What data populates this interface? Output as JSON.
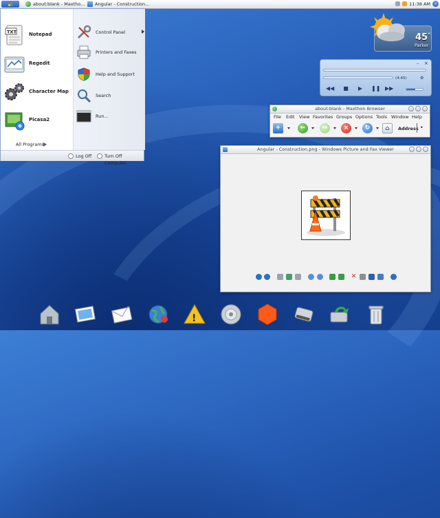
{
  "colors": {
    "accent": "#2b5fbf",
    "desktop": "#2a63bd",
    "taskbar": "#e8ecf2"
  },
  "taskbar": {
    "start_icon": "windows-logo-icon",
    "tasks": [
      {
        "label": "about:blank - Maxtho...",
        "icon": "maxthon-globe-icon"
      },
      {
        "label": "Angular - Construction...",
        "icon": "picture-viewer-icon"
      }
    ],
    "tray": {
      "time": "11:38 AM",
      "icons": [
        "network-icon",
        "volume-icon"
      ]
    },
    "search_icon": "search-icon"
  },
  "start_menu": {
    "pinned": [
      {
        "label": "Notepad",
        "icon": "notepad-txt-icon"
      },
      {
        "label": "Regedit",
        "icon": "regedit-icon"
      },
      {
        "label": "Character Map",
        "icon": "character-map-gears-icon"
      },
      {
        "label": "Picasa2",
        "icon": "picasa-icon"
      }
    ],
    "all_programs": "All Programs",
    "right_items": [
      {
        "label": "Control Panel",
        "icon": "control-panel-tools-icon",
        "submenu": true
      },
      {
        "label": "Printers and Faxes",
        "icon": "printer-icon",
        "submenu": false
      },
      {
        "label": "Help and Support",
        "icon": "help-shield-icon",
        "submenu": false
      },
      {
        "label": "Search",
        "icon": "search-magnifier-icon",
        "submenu": false
      },
      {
        "label": "Run...",
        "icon": "run-icon",
        "submenu": false
      }
    ],
    "footer": {
      "log_off": "Log Off",
      "turn_off": "Turn Off Computer"
    }
  },
  "weather": {
    "temperature": "45",
    "degree": "°",
    "city": "Parker",
    "icon": "cloudy-sun-icon"
  },
  "media_player": {
    "time": "(4:45)",
    "controls": [
      "rewind-icon",
      "stop-icon",
      "play-icon",
      "pause-icon",
      "fast-forward-icon"
    ],
    "seek_fraction": 0.0,
    "volume_fraction": 0.55
  },
  "browser": {
    "title": "about:blank - Maxthon Browser",
    "menu": [
      "File",
      "Edit",
      "View",
      "Favorites",
      "Groups",
      "Options",
      "Tools",
      "Window",
      "Help"
    ],
    "address_label": "Address",
    "toolbar_icons": [
      "new-tab-icon",
      "back-icon",
      "forward-icon",
      "stop-icon",
      "refresh-icon",
      "home-icon"
    ]
  },
  "viewer": {
    "title": "Angular - Construction.png - Windows Picture and Fax Viewer",
    "image_icon": "construction-barrier-icon",
    "toolbar_icons": [
      "previous-image-icon",
      "next-image-icon",
      "best-fit-icon",
      "actual-size-icon",
      "slideshow-icon",
      "zoom-in-icon",
      "zoom-out-icon",
      "rotate-clockwise-icon",
      "rotate-counterclockwise-icon",
      "delete-icon",
      "print-icon",
      "save-icon",
      "edit-icon",
      "help-icon"
    ]
  },
  "dock": {
    "items": [
      "home-folder-icon",
      "photos-icon",
      "mail-envelope-icon",
      "web-globe-icon",
      "caution-sign-icon",
      "media-disc-icon",
      "shield-hexagon-icon",
      "drive-icon",
      "sync-icon",
      "trash-icon"
    ]
  }
}
